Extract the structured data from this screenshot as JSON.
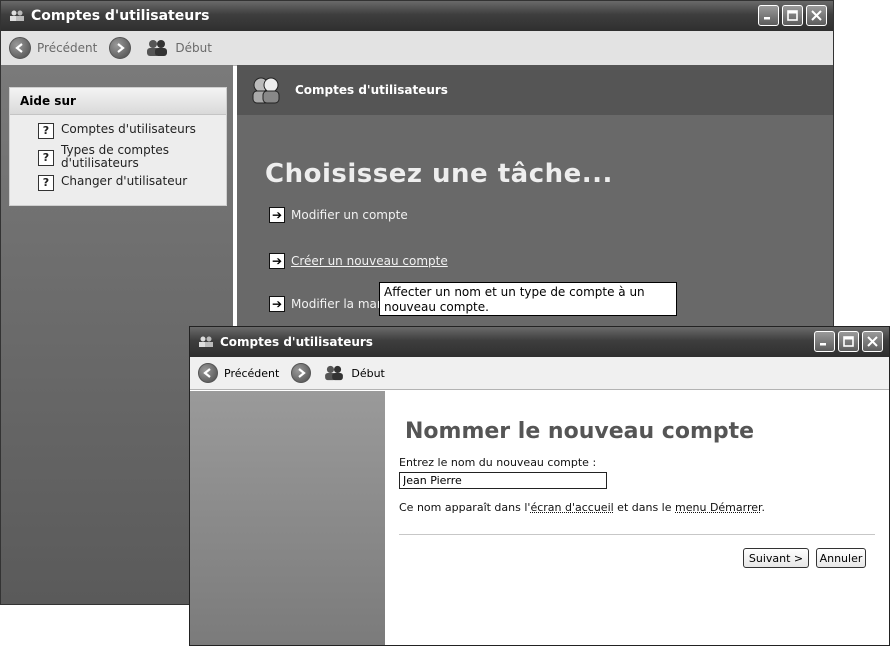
{
  "window1": {
    "title": "Comptes d'utilisateurs",
    "toolbar": {
      "back_label": "Précédent",
      "home_label": "Début"
    },
    "help": {
      "header": "Aide sur",
      "items": [
        {
          "label": "Comptes d'utilisateurs"
        },
        {
          "label": "Types de comptes d'utilisateurs"
        },
        {
          "label": "Changer d'utilisateur"
        }
      ]
    },
    "main": {
      "header_title": "Comptes d'utilisateurs",
      "heading": "Choisissez une tâche...",
      "tasks": [
        {
          "label": "Modifier un compte"
        },
        {
          "label": "Créer un nouveau compte"
        },
        {
          "label": "Modifier la manièr"
        }
      ]
    },
    "tooltip": "Affecter un nom et un type de compte à un nouveau compte."
  },
  "window2": {
    "title": "Comptes d'utilisateurs",
    "toolbar": {
      "back_label": "Précédent",
      "home_label": "Début"
    },
    "main": {
      "heading": "Nommer le nouveau compte",
      "field_label": "Entrez le nom du nouveau compte :",
      "field_value": "Jean Pierre",
      "hint_prefix": "Ce nom apparaît dans l'",
      "hint_link1": "écran d'accueil",
      "hint_middle": " et dans le ",
      "hint_link2": "menu Démarrer",
      "hint_suffix": ".",
      "next_button": "Suivant >",
      "cancel_button": "Annuler"
    }
  }
}
